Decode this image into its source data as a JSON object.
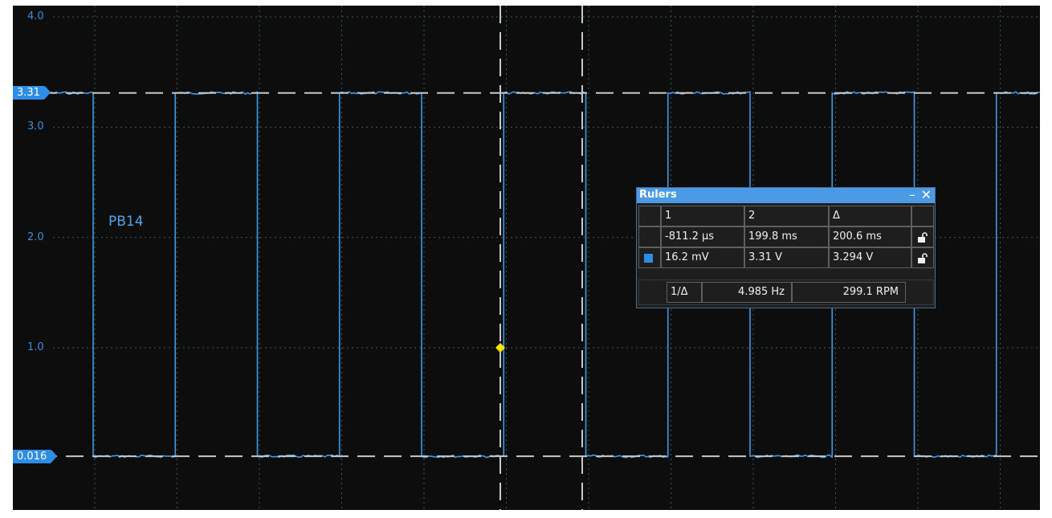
{
  "channel": {
    "name": "PB14",
    "color": "#3d9be9"
  },
  "y_axis": {
    "ticks": [
      {
        "label": "4.0",
        "value": 4.0
      },
      {
        "label": "3.0",
        "value": 3.0
      },
      {
        "label": "2.0",
        "value": 2.0
      },
      {
        "label": "1.0",
        "value": 1.0
      }
    ]
  },
  "ruler_markers": {
    "high_label": "3.31",
    "high_value": 3.31,
    "low_label": "0.016",
    "low_value": 0.016
  },
  "rulers_panel": {
    "title": "Rulers",
    "minimize_symbol": "–",
    "close_symbol": "✕",
    "headers": [
      "1",
      "2",
      "Δ"
    ],
    "time_row": {
      "r1": "-811.2 μs",
      "r2": "199.8 ms",
      "delta": "200.6 ms",
      "lock_icon": "unlock-icon"
    },
    "voltage_row": {
      "swatch_color": "#2e8de6",
      "r1": "16.2 mV",
      "r2": "3.31 V",
      "delta": "3.294 V",
      "lock_icon": "unlock-icon"
    },
    "frequency_row": {
      "label": "1/Δ",
      "hz": "4.985 Hz",
      "rpm": "299.1 RPM"
    }
  },
  "colors": {
    "background": "#0d0d0d",
    "grid": "#2f5f66",
    "trace": "#3d9be9",
    "ruler_line": "#c8c8c8",
    "trigger": "#ffe600"
  }
}
